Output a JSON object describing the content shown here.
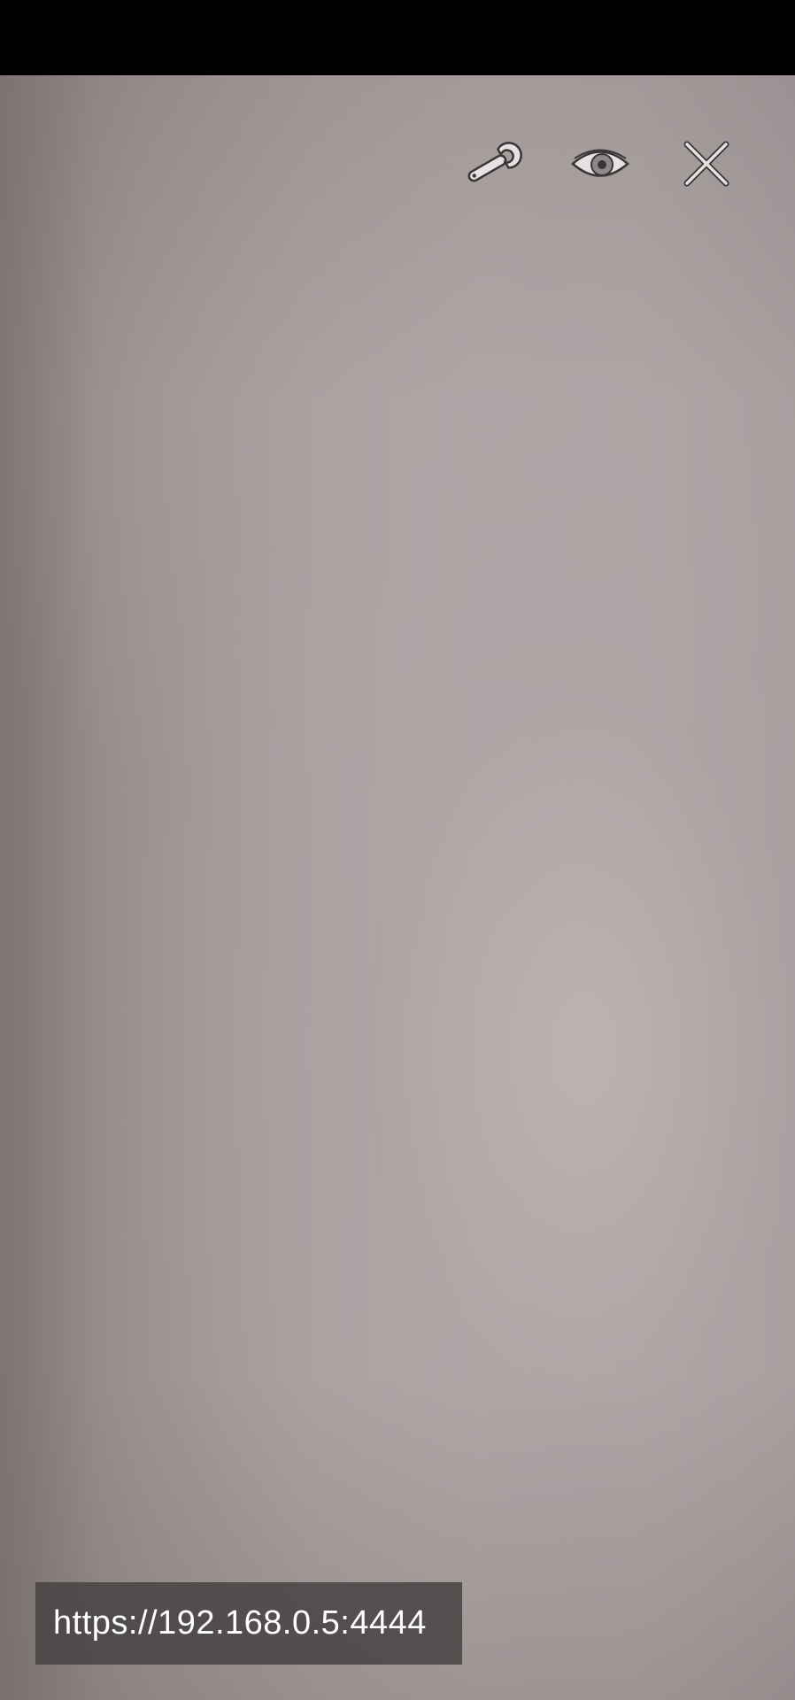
{
  "status_bar": {},
  "toolbar": {
    "icons": [
      {
        "name": "wrench-icon",
        "meaning": "settings"
      },
      {
        "name": "eye-icon",
        "meaning": "view / preview"
      },
      {
        "name": "close-icon",
        "meaning": "close"
      }
    ],
    "icon_color": "#e6e2e2",
    "icon_outline_color": "#3a3636"
  },
  "camera_view": {
    "background_tone": "#aba1a1"
  },
  "overlay": {
    "url": "https://192.168.0.5:4444"
  }
}
